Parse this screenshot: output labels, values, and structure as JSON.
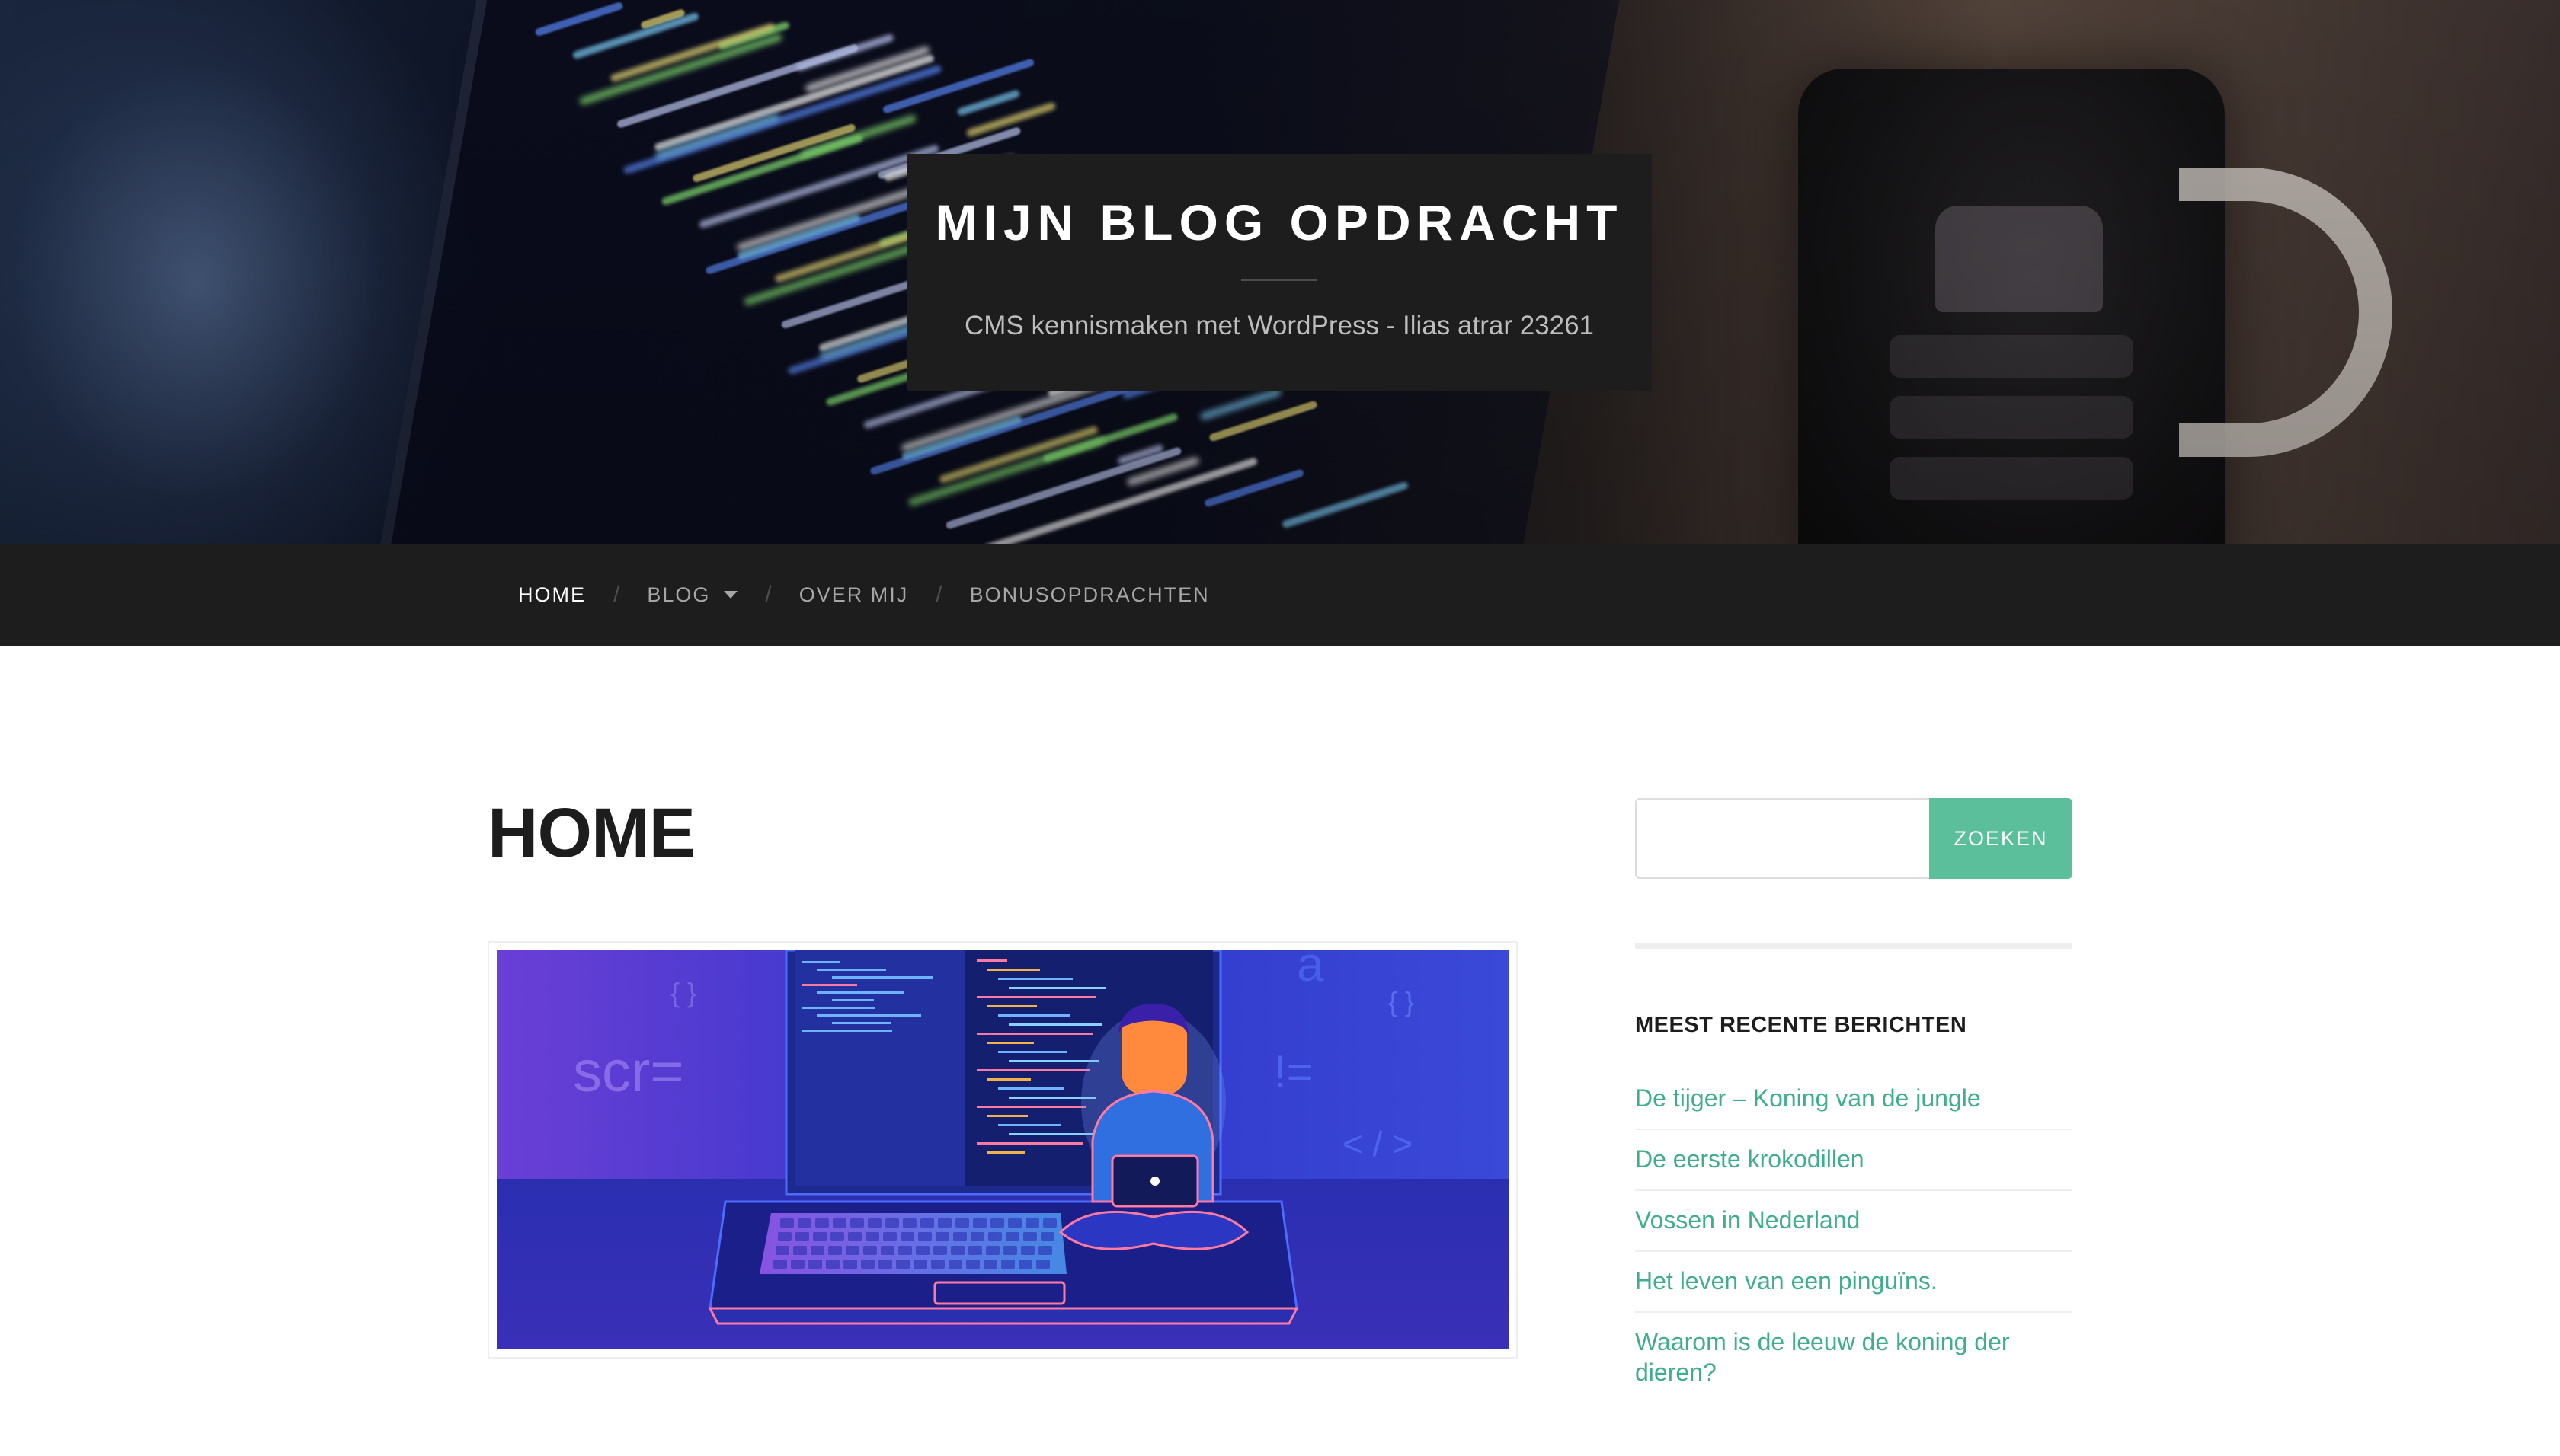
{
  "site": {
    "title": "MIJN BLOG OPDRACHT",
    "description": "CMS kennismaken met WordPress - Ilias atrar 23261"
  },
  "nav": {
    "items": [
      {
        "label": "HOME",
        "active": true
      },
      {
        "label": "BLOG",
        "has_dropdown": true
      },
      {
        "label": "OVER MIJ"
      },
      {
        "label": "BONUSOPDRACHTEN"
      }
    ],
    "separator": "/"
  },
  "main": {
    "page_title": "HOME",
    "featured_image": {
      "code_text_1": "scr=",
      "code_text_2": "{ }",
      "code_text_3": "!=",
      "code_text_4": "< / >",
      "code_text_5": "a"
    }
  },
  "sidebar": {
    "search": {
      "value": "",
      "button_label": "ZOEKEN"
    },
    "recent_posts": {
      "title": "MEEST RECENTE BERICHTEN",
      "items": [
        "De tijger – Koning van de jungle",
        "De eerste krokodillen",
        "Vossen in Nederland",
        "Het leven van een pinguïns.",
        "Waarom is de leeuw de koning der dieren?"
      ]
    }
  },
  "colors": {
    "accent": "#5cbf9c",
    "link": "#3fae8b",
    "dark": "#1d1d1d"
  }
}
